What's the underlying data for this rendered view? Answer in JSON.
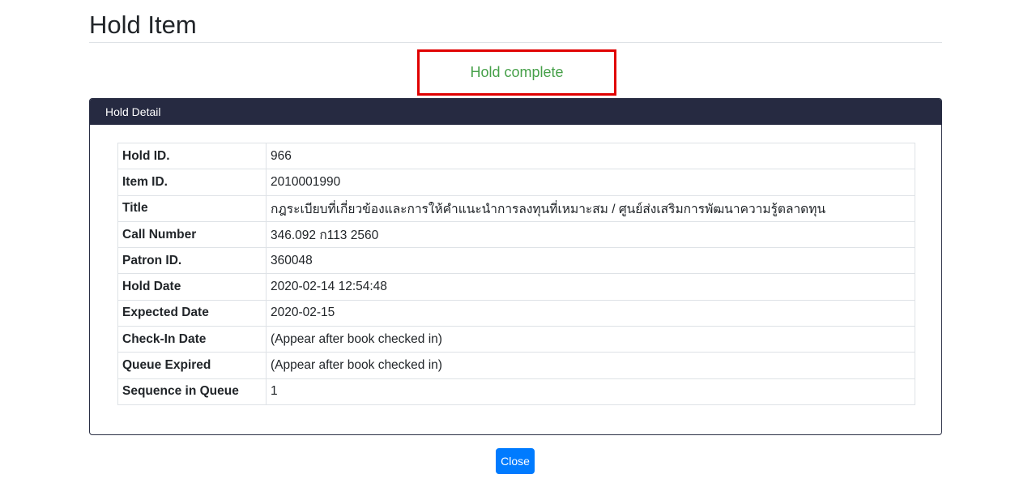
{
  "page": {
    "title": "Hold Item"
  },
  "status": {
    "message": "Hold complete",
    "color": "#46a049",
    "highlight_color": "#e00000"
  },
  "card": {
    "header": "Hold Detail",
    "header_color": "#262a41",
    "rows": [
      {
        "label": "Hold ID.",
        "value": "966"
      },
      {
        "label": "Item ID.",
        "value": "2010001990"
      },
      {
        "label": "Title",
        "value": "กฎระเบียบที่เกี่ยวข้องและการให้คำแนะนำการลงทุนที่เหมาะสม / ศูนย์ส่งเสริมการพัฒนาความรู้ตลาดทุน"
      },
      {
        "label": "Call Number",
        "value": "346.092 ก113 2560"
      },
      {
        "label": "Patron ID.",
        "value": "360048"
      },
      {
        "label": "Hold Date",
        "value": "2020-02-14 12:54:48"
      },
      {
        "label": "Expected Date",
        "value": "2020-02-15"
      },
      {
        "label": "Check-In Date",
        "value": "(Appear after book checked in)"
      },
      {
        "label": "Queue Expired",
        "value": "(Appear after book checked in)"
      },
      {
        "label": "Sequence in Queue",
        "value": "1"
      }
    ]
  },
  "actions": {
    "close_label": "Close",
    "primary_color": "#007bff"
  }
}
